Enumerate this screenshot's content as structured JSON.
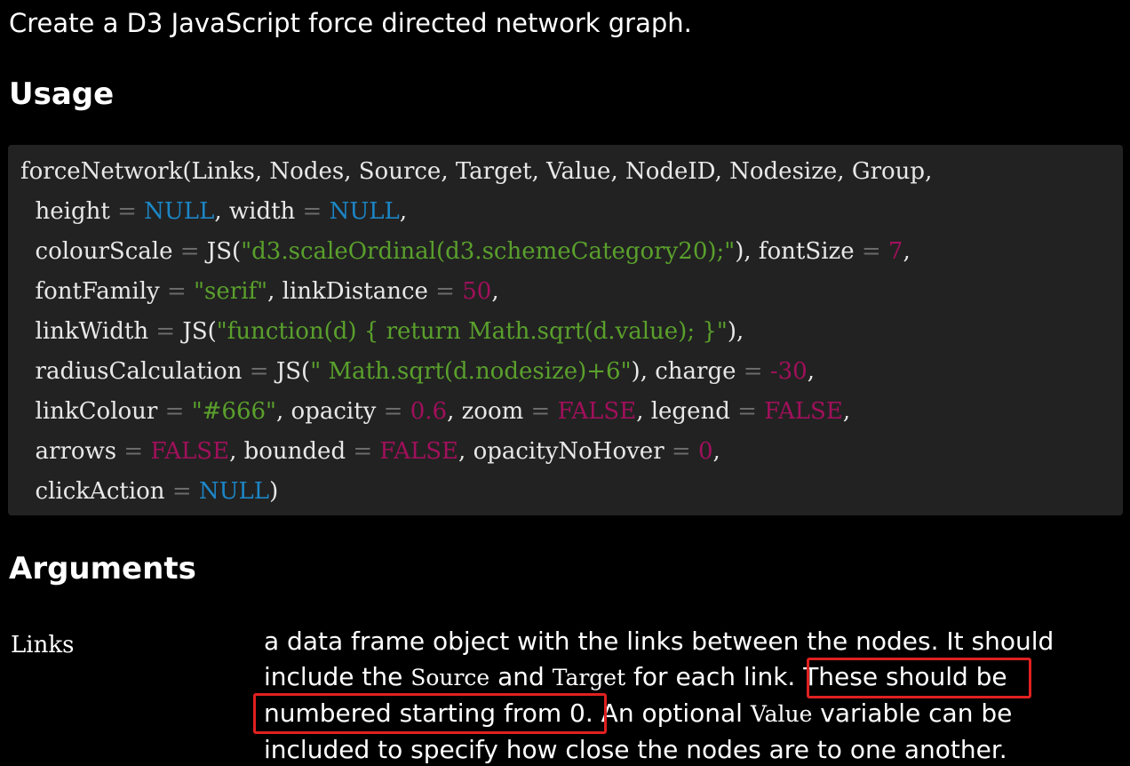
{
  "intro": "Create a D3 JavaScript force directed network graph.",
  "usage_heading": "Usage",
  "code": {
    "l1": {
      "a": "forceNetwork(Links, Nodes, Source, Target, Value, NodeID, Nodesize, Group,"
    },
    "l2": {
      "a": "  height ",
      "op1": "=",
      "sp1": " ",
      "v1": "NULL",
      "b": ", width ",
      "op2": "=",
      "sp2": " ",
      "v2": "NULL",
      "c": ","
    },
    "l3": {
      "a": "  colourScale ",
      "op1": "=",
      "b": " JS(",
      "s1": "\"d3.scaleOrdinal(d3.schemeCategory20);\"",
      "c": "), fontSize ",
      "op2": "=",
      "sp2": " ",
      "n1": "7",
      "d": ","
    },
    "l4": {
      "a": "  fontFamily ",
      "op1": "=",
      "sp1": " ",
      "s1": "\"serif\"",
      "b": ", linkDistance ",
      "op2": "=",
      "sp2": " ",
      "n1": "50",
      "c": ","
    },
    "l5": {
      "a": "  linkWidth ",
      "op1": "=",
      "b": " JS(",
      "s1": "\"function(d) { return Math.sqrt(d.value); }\"",
      "c": "),"
    },
    "l6": {
      "a": "  radiusCalculation ",
      "op1": "=",
      "b": " JS(",
      "s1": "\" Math.sqrt(d.nodesize)+6\"",
      "c": "), charge ",
      "op2": "=",
      "sp2": " ",
      "n1": "-30",
      "d": ","
    },
    "l7": {
      "a": "  linkColour ",
      "op1": "=",
      "sp1": " ",
      "s1": "\"#666\"",
      "b": ", opacity ",
      "op2": "=",
      "sp2": " ",
      "n1": "0.6",
      "c": ", zoom ",
      "op3": "=",
      "sp3": " ",
      "n2": "FALSE",
      "d": ", legend ",
      "op4": "=",
      "sp4": " ",
      "n3": "FALSE",
      "e": ","
    },
    "l8": {
      "a": "  arrows ",
      "op1": "=",
      "sp1": " ",
      "n1": "FALSE",
      "b": ", bounded ",
      "op2": "=",
      "sp2": " ",
      "n2": "FALSE",
      "c": ", opacityNoHover ",
      "op3": "=",
      "sp3": " ",
      "n3": "0",
      "d": ","
    },
    "l9": {
      "a": "  clickAction ",
      "op1": "=",
      "sp1": " ",
      "v1": "NULL",
      "b": ")"
    }
  },
  "arguments_heading": "Arguments",
  "arguments": [
    {
      "name": "Links",
      "desc_1": "a data frame object with the links between the nodes. It should include the ",
      "code_1": "Source",
      "desc_2": " and ",
      "code_2": "Target",
      "desc_3": " for each link. ",
      "highlight": "These should be numbered starting from 0.",
      "desc_4": " An optional ",
      "code_3": "Value",
      "desc_5": " variable can be included to specify how close the nodes are to one another."
    }
  ],
  "colors": {
    "background": "#000000",
    "code_background": "#222222",
    "keyword": "#1c86c6",
    "string": "#5aa02c",
    "number": "#a0105b",
    "highlight_box": "#e02020"
  }
}
